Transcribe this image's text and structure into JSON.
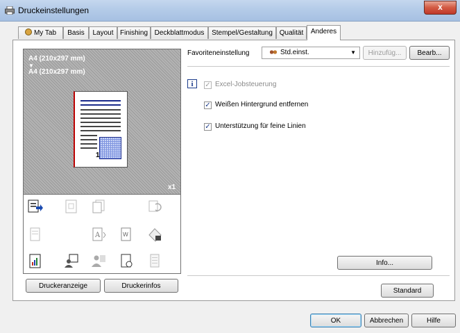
{
  "window": {
    "title": "Druckeinstellungen",
    "close_glyph": "x",
    "title_icon": "printer-icon"
  },
  "tabs": [
    {
      "label": "My Tab",
      "icon": "user-icon"
    },
    {
      "label": "Basis"
    },
    {
      "label": "Layout"
    },
    {
      "label": "Finishing"
    },
    {
      "label": "Deckblattmodus"
    },
    {
      "label": "Stempel/Gestaltung"
    },
    {
      "label": "Qualität"
    },
    {
      "label": "Anderes",
      "active": true
    }
  ],
  "preview": {
    "source_size": "A4 (210x297 mm)",
    "arrow": "▼",
    "target_size": "A4 (210x297 mm)",
    "page_number": "1",
    "copies": "x1"
  },
  "buttons": {
    "druckeranzeige": "Druckeranzeige",
    "druckerinfos": "Druckerinfos",
    "hinzufuegen": "Hinzufüg...",
    "bearbeiten": "Bearb...",
    "info": "Info...",
    "standard": "Standard",
    "ok": "OK",
    "abbrechen": "Abbrechen",
    "hilfe": "Hilfe"
  },
  "favorites": {
    "label": "Favoriteneinstellung",
    "selected": "Std.einst.",
    "icon": "users-icon"
  },
  "options": {
    "info_icon": "i",
    "excel": {
      "label": "Excel-Jobsteuerung",
      "checked": true,
      "disabled": true
    },
    "white_bg": {
      "label": "Weißen Hintergrund entfernen",
      "checked": true
    },
    "fine_lines": {
      "label": "Unterstützung für feine Linien",
      "checked": true
    }
  },
  "colors": {
    "accent": "#1a2a8a",
    "title_bg": "#b4cbe8",
    "close": "#c0392b"
  }
}
